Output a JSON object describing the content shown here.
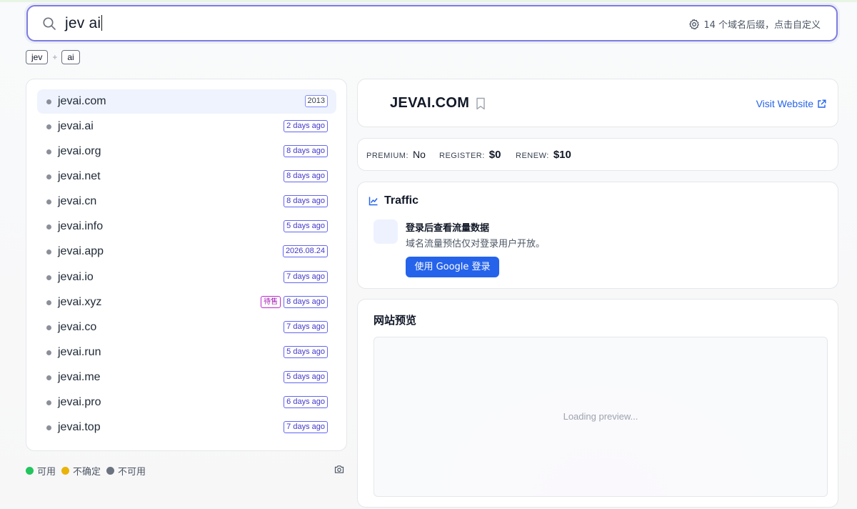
{
  "search": {
    "query": "jev ai",
    "settings_text": "14 个域名后缀，点击自定义"
  },
  "chips": [
    "jev",
    "ai"
  ],
  "chip_separator": "+",
  "domains": [
    {
      "name": "jevai.com",
      "tags": [
        {
          "text": "2013",
          "kind": "plain"
        }
      ],
      "active": true
    },
    {
      "name": "jevai.ai",
      "tags": [
        {
          "text": "2 days ago",
          "kind": "date"
        }
      ]
    },
    {
      "name": "jevai.org",
      "tags": [
        {
          "text": "8 days ago",
          "kind": "date"
        }
      ]
    },
    {
      "name": "jevai.net",
      "tags": [
        {
          "text": "8 days ago",
          "kind": "date"
        }
      ]
    },
    {
      "name": "jevai.cn",
      "tags": [
        {
          "text": "8 days ago",
          "kind": "date"
        }
      ]
    },
    {
      "name": "jevai.info",
      "tags": [
        {
          "text": "5 days ago",
          "kind": "date"
        }
      ]
    },
    {
      "name": "jevai.app",
      "tags": [
        {
          "text": "2026.08.24",
          "kind": "date"
        }
      ]
    },
    {
      "name": "jevai.io",
      "tags": [
        {
          "text": "7 days ago",
          "kind": "date"
        }
      ]
    },
    {
      "name": "jevai.xyz",
      "tags": [
        {
          "text": "待售",
          "kind": "sale"
        },
        {
          "text": "8 days ago",
          "kind": "date"
        }
      ]
    },
    {
      "name": "jevai.co",
      "tags": [
        {
          "text": "7 days ago",
          "kind": "date"
        }
      ]
    },
    {
      "name": "jevai.run",
      "tags": [
        {
          "text": "5 days ago",
          "kind": "date"
        }
      ]
    },
    {
      "name": "jevai.me",
      "tags": [
        {
          "text": "5 days ago",
          "kind": "date"
        }
      ]
    },
    {
      "name": "jevai.pro",
      "tags": [
        {
          "text": "6 days ago",
          "kind": "date"
        }
      ]
    },
    {
      "name": "jevai.top",
      "tags": [
        {
          "text": "7 days ago",
          "kind": "date"
        }
      ]
    }
  ],
  "legend": [
    {
      "label": "可用",
      "color": "#22c55e"
    },
    {
      "label": "不确定",
      "color": "#eab308"
    },
    {
      "label": "不可用",
      "color": "#6b7280"
    }
  ],
  "detail": {
    "title": "JEVAI.COM",
    "visit_label": "Visit Website",
    "premium_label": "PREMIUM:",
    "premium_value": "No",
    "register_label": "REGISTER:",
    "register_value": "$0",
    "renew_label": "RENEW:",
    "renew_value": "$10"
  },
  "traffic": {
    "title": "Traffic",
    "login_title": "登录后查看流量数据",
    "login_desc": "域名流量预估仅对登录用户开放。",
    "login_button": "使用 Google 登录"
  },
  "preview": {
    "title": "网站预览",
    "loading": "Loading preview..."
  },
  "colors": {
    "accent": "#2563eb",
    "search_border": "#7c7ce0",
    "active_row": "#eff3fd"
  }
}
